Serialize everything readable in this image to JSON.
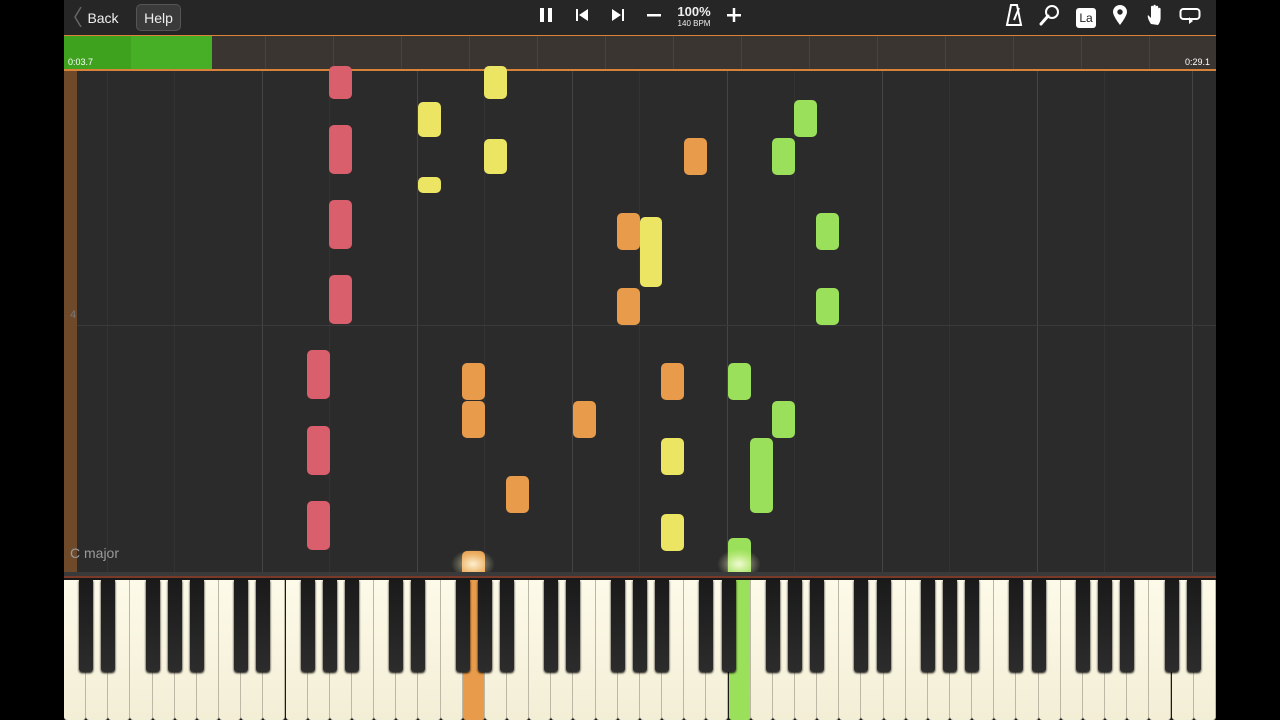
{
  "toolbar": {
    "back_label": "Back",
    "help_label": "Help",
    "tempo_percent": "100%",
    "tempo_bpm": "140 BPM",
    "label_mode": "La",
    "icons": [
      "pause-icon",
      "skip-back-icon",
      "skip-forward-icon",
      "minus-icon",
      "plus-icon",
      "metronome-icon",
      "zoom-icon",
      "label-icon",
      "location-pin-icon",
      "hand-icon",
      "loop-icon"
    ]
  },
  "timeline": {
    "current_time": "0:03.7",
    "total_time": "0:29.1",
    "progress": 0.127
  },
  "roll": {
    "measure_number": "4",
    "key_signature": "C major"
  },
  "colors": {
    "red": "#d95f6c",
    "orange": "#e89b4a",
    "yellow": "#ece563",
    "green": "#9be05b",
    "played_green": "#3ea21f",
    "accent_orange": "#d9823a"
  }
}
